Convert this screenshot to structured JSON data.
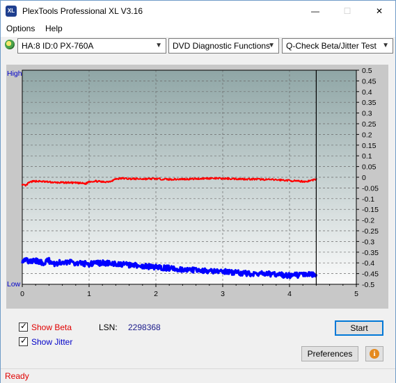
{
  "window": {
    "title": "PlexTools Professional XL V3.16",
    "app_icon_text": "XL",
    "minimize": "—",
    "restore": "☐",
    "close": "✕"
  },
  "menu": {
    "options": "Options",
    "help": "Help"
  },
  "toolbar": {
    "drive": "HA:8 ID:0  PX-760A",
    "function": "DVD Diagnostic Functions",
    "test": "Q-Check Beta/Jitter Test",
    "dropdown_arrow": "▼"
  },
  "chart_data": {
    "type": "line",
    "left_axis_labels": {
      "top": "High",
      "bottom": "Low"
    },
    "x_ticks": [
      "0",
      "1",
      "2",
      "3",
      "4",
      "5"
    ],
    "xlim": [
      0,
      5
    ],
    "y_ticks": [
      "0.5",
      "0.45",
      "0.4",
      "0.35",
      "0.3",
      "0.25",
      "0.2",
      "0.15",
      "0.1",
      "0.05",
      "0",
      "-0.05",
      "-0.1",
      "-0.15",
      "-0.2",
      "-0.25",
      "-0.3",
      "-0.35",
      "-0.4",
      "-0.45",
      "-0.5"
    ],
    "ylim": [
      -0.5,
      0.5
    ],
    "grid": true,
    "end_marker_x": 4.4,
    "series": [
      {
        "color": "#ff0000",
        "x": [
          0,
          0.05,
          0.1,
          0.15,
          0.2,
          0.3,
          0.4,
          0.5,
          0.7,
          0.9,
          0.95,
          1.0,
          1.1,
          1.2,
          1.3,
          1.35,
          1.4,
          1.5,
          1.6,
          1.8,
          2.0,
          2.2,
          2.5,
          2.8,
          3.0,
          3.3,
          3.6,
          3.9,
          4.1,
          4.25,
          4.35,
          4.4
        ],
        "y": [
          -0.035,
          -0.04,
          -0.025,
          -0.02,
          -0.018,
          -0.02,
          -0.022,
          -0.025,
          -0.025,
          -0.028,
          -0.03,
          -0.02,
          -0.018,
          -0.022,
          -0.02,
          -0.015,
          -0.008,
          -0.005,
          -0.007,
          -0.008,
          -0.007,
          -0.01,
          -0.008,
          -0.005,
          -0.006,
          -0.008,
          -0.01,
          -0.013,
          -0.018,
          -0.02,
          -0.013,
          -0.008
        ]
      },
      {
        "color": "#0000ff",
        "x": [
          0,
          0.05,
          0.1,
          0.2,
          0.3,
          0.4,
          0.5,
          0.6,
          0.8,
          1.0,
          1.2,
          1.4,
          1.6,
          1.8,
          2.0,
          2.2,
          2.4,
          2.6,
          2.8,
          3.0,
          3.2,
          3.4,
          3.6,
          3.8,
          4.0,
          4.2,
          4.4
        ],
        "y": [
          -0.39,
          -0.38,
          -0.395,
          -0.39,
          -0.4,
          -0.39,
          -0.405,
          -0.395,
          -0.4,
          -0.405,
          -0.4,
          -0.405,
          -0.41,
          -0.415,
          -0.42,
          -0.425,
          -0.43,
          -0.435,
          -0.44,
          -0.44,
          -0.445,
          -0.45,
          -0.45,
          -0.455,
          -0.46,
          -0.455,
          -0.455
        ]
      }
    ]
  },
  "options_panel": {
    "show_beta": "Show Beta",
    "show_jitter": "Show Jitter",
    "show_beta_checked": true,
    "show_jitter_checked": true,
    "lsn_label": "LSN:",
    "lsn_value": "2298368",
    "start_button": "Start",
    "preferences_button": "Preferences",
    "info_icon": "i",
    "checkmark": "✓"
  },
  "status": {
    "text": "Ready"
  },
  "colors": {
    "beta": "#ff0000",
    "jitter": "#0000ff",
    "accent": "#0078d7",
    "status": "#e00000"
  }
}
